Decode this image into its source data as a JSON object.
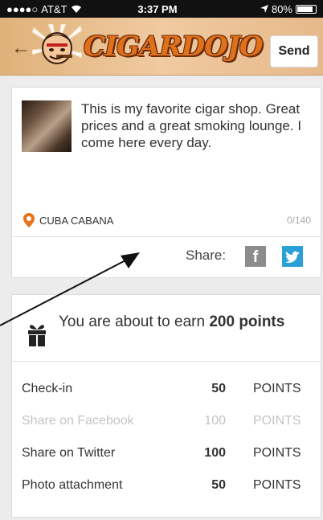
{
  "status_bar": {
    "signal": "●●●●○",
    "carrier": "AT&T",
    "time": "3:37 PM",
    "battery": "80%",
    "battery_level": 0.8
  },
  "nav": {
    "logo_text": "CIGARDOJO",
    "send_label": "Send"
  },
  "post": {
    "text": "This is my favorite cigar shop. Great prices and a great smoking lounge. I come here every day.",
    "location": "CUBA CABANA",
    "char_count": "0/140",
    "share_label": "Share:",
    "facebook_glyph": "f"
  },
  "points": {
    "earn_prefix": "You are about to earn",
    "earn_amount": "200",
    "earn_suffix": "points",
    "rows": [
      {
        "label": "Check-in",
        "value": "50",
        "unit": "POINTS",
        "active": true
      },
      {
        "label": "Share on Facebook",
        "value": "100",
        "unit": "POINTS",
        "active": false
      },
      {
        "label": "Share on Twitter",
        "value": "100",
        "unit": "POINTS",
        "active": true
      },
      {
        "label": "Photo attachment",
        "value": "50",
        "unit": "POINTS",
        "active": true
      }
    ]
  },
  "colors": {
    "brand_orange": "#e0711b",
    "twitter_blue": "#2a9fd8",
    "pin_orange": "#e8731e"
  }
}
